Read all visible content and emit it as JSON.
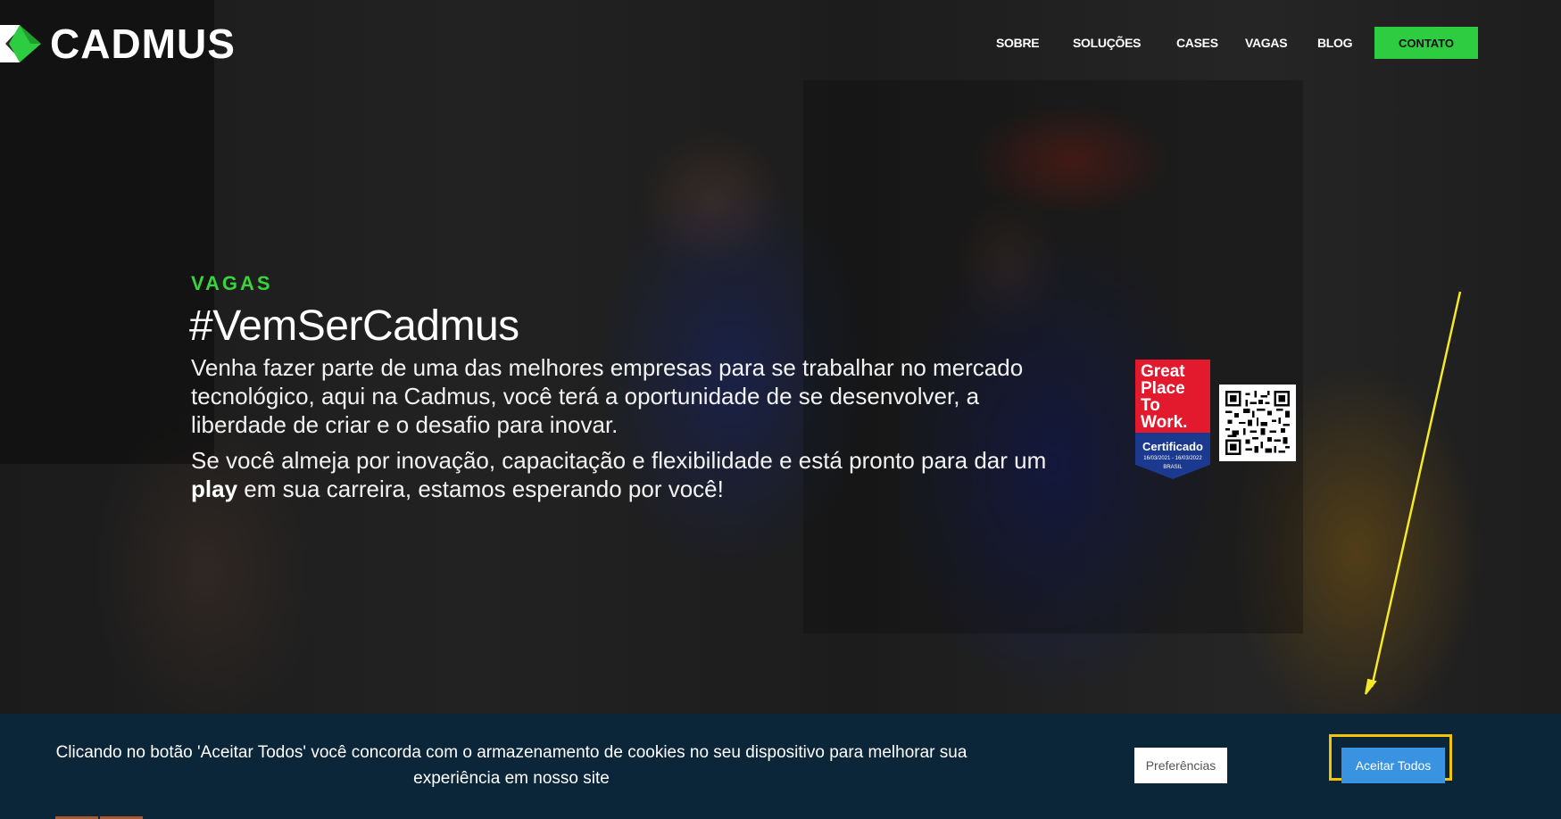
{
  "brand": {
    "name": "CADMUS",
    "accent_color": "#2ecc40",
    "logo_icon": "cadmus-diamond-logo"
  },
  "nav": {
    "items": [
      {
        "label": "SOBRE"
      },
      {
        "label": "SOLUÇÕES"
      },
      {
        "label": "CASES"
      },
      {
        "label": "VAGAS"
      },
      {
        "label": "BLOG"
      }
    ],
    "cta_label": "CONTATO"
  },
  "hero": {
    "eyebrow": "VAGAS",
    "headline": "#VemSerCadmus",
    "paragraph1": "Venha fazer parte de uma das melhores empresas para se trabalhar no mercado tecnológico, aqui na Cadmus, você terá a oportunidade de se desenvolver, a liberdade de criar e o desafio para inovar.",
    "paragraph2_before": "Se você almeja por inovação, capacitação e flexibilidade e está pronto para dar um ",
    "paragraph2_bold": "play",
    "paragraph2_after": " em sua carreira, estamos esperando por você!"
  },
  "badge": {
    "title": "Great\nPlace\nTo\nWork.",
    "certified": "Certificado",
    "dates": "16/03/2021 - 16/03/2022",
    "country": "BRASIL",
    "red": "#e3192e",
    "blue": "#1b3a8f",
    "qr_icon": "qr-code-icon"
  },
  "cookie_banner": {
    "text": "Clicando no botão 'Aceitar Todos' você concorda com o armazenamento de cookies no seu dispositivo para melhorar sua experiência em nosso site",
    "preferences_label": "Preferências",
    "accept_label": "Aceitar Todos",
    "background": "#0b2539",
    "accept_color": "#3a93e0",
    "highlight_color": "#f5c400"
  }
}
